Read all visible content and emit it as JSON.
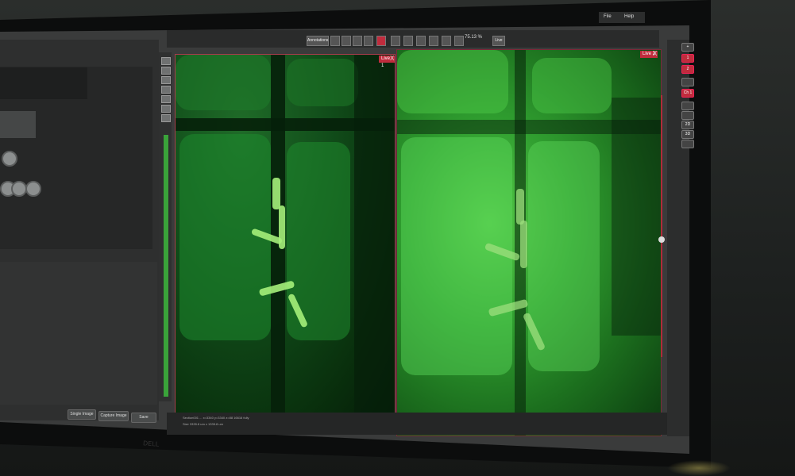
{
  "menu": {
    "file": "File",
    "help": "Help"
  },
  "toolbar": {
    "annotations": "Annotations",
    "zoom": "75.13 %",
    "live": "Live"
  },
  "sidebar": {
    "buttons": [
      {
        "label": "Single Image"
      },
      {
        "label": "Capture Image"
      },
      {
        "label": "Save"
      }
    ]
  },
  "viewports": [
    {
      "label": "Live 1",
      "close": "X"
    },
    {
      "label": "Live 2",
      "close": "X"
    }
  ],
  "right_tools": {
    "ch_label": "Ch 1",
    "btn_2d": "2D",
    "btn_3d": "3D",
    "btn_1": "1",
    "btn_2": "2"
  },
  "status": {
    "line1": "Section001 ... x=3340 y=3340 z=88  16616 fully",
    "line2": "Size 3335.8 um x 1335.8 um"
  },
  "brand": "DELL"
}
